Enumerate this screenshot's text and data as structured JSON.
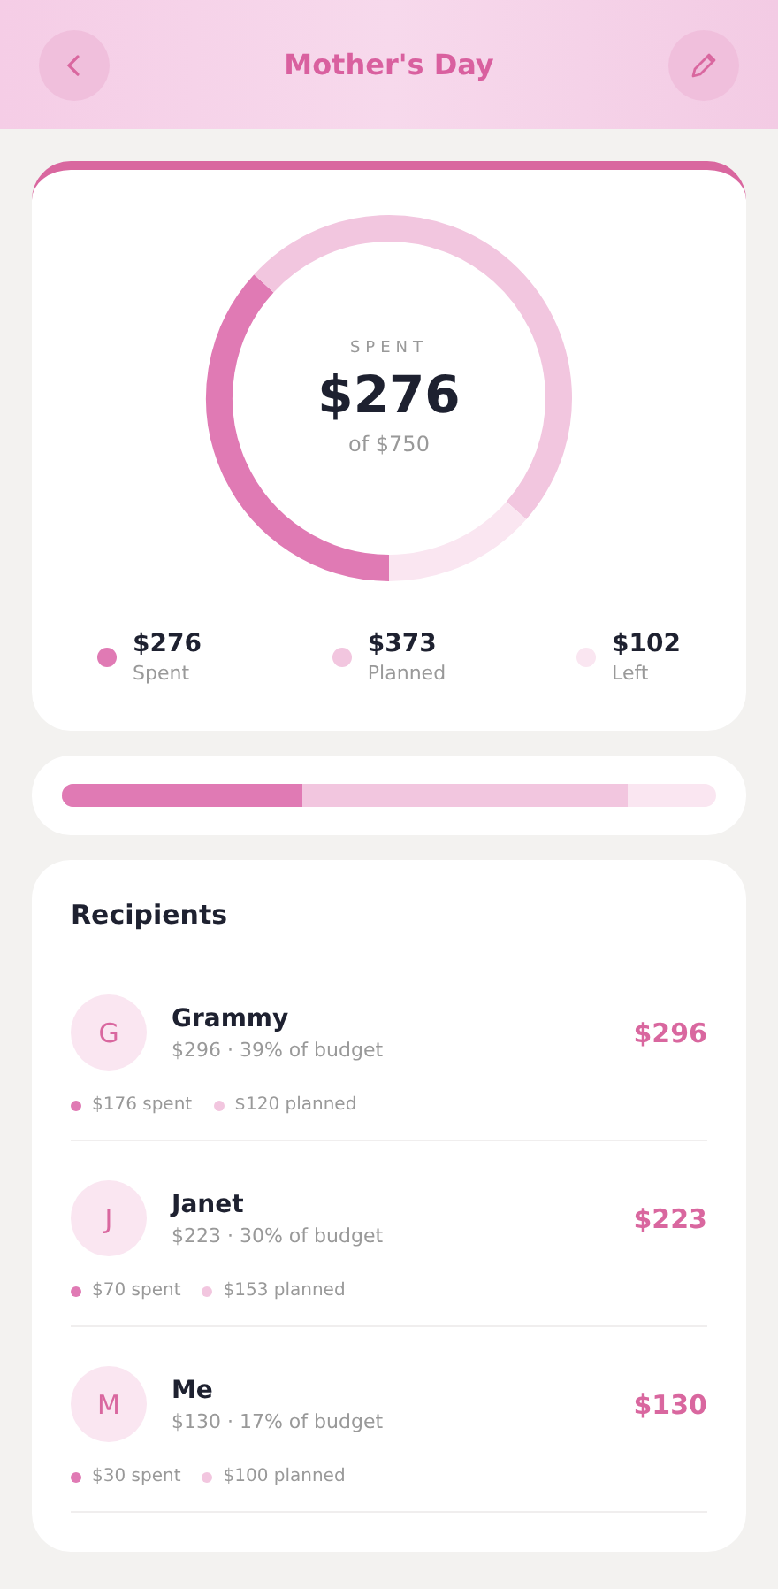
{
  "header": {
    "title": "Mother's Day"
  },
  "summary": {
    "label": "SPENT",
    "amount": "$276",
    "of": "of $750"
  },
  "legend": [
    {
      "amount": "$276",
      "label": "Spent",
      "color": "#e07ab4"
    },
    {
      "amount": "$373",
      "label": "Planned",
      "color": "#f2c6df"
    },
    {
      "amount": "$102",
      "label": "Left",
      "color": "#fae6f1"
    }
  ],
  "budget_bar": {
    "spent": {
      "level": 0.368
    },
    "spent_and_planned": {
      "level": 0.865
    }
  },
  "recipients": {
    "title": "Recipients",
    "items": [
      {
        "initial": "G",
        "name": "Grammy",
        "detail": "$296 · 39% of budget",
        "total": "$296",
        "spent": "$176 spent",
        "planned": "$120 planned"
      },
      {
        "initial": "J",
        "name": "Janet",
        "detail": "$223 · 30% of budget",
        "total": "$223",
        "spent": "$70 spent",
        "planned": "$153 planned"
      },
      {
        "initial": "M",
        "name": "Me",
        "detail": "$130 · 17% of budget",
        "total": "$130",
        "spent": "$30 spent",
        "planned": "$100 planned"
      }
    ]
  }
}
